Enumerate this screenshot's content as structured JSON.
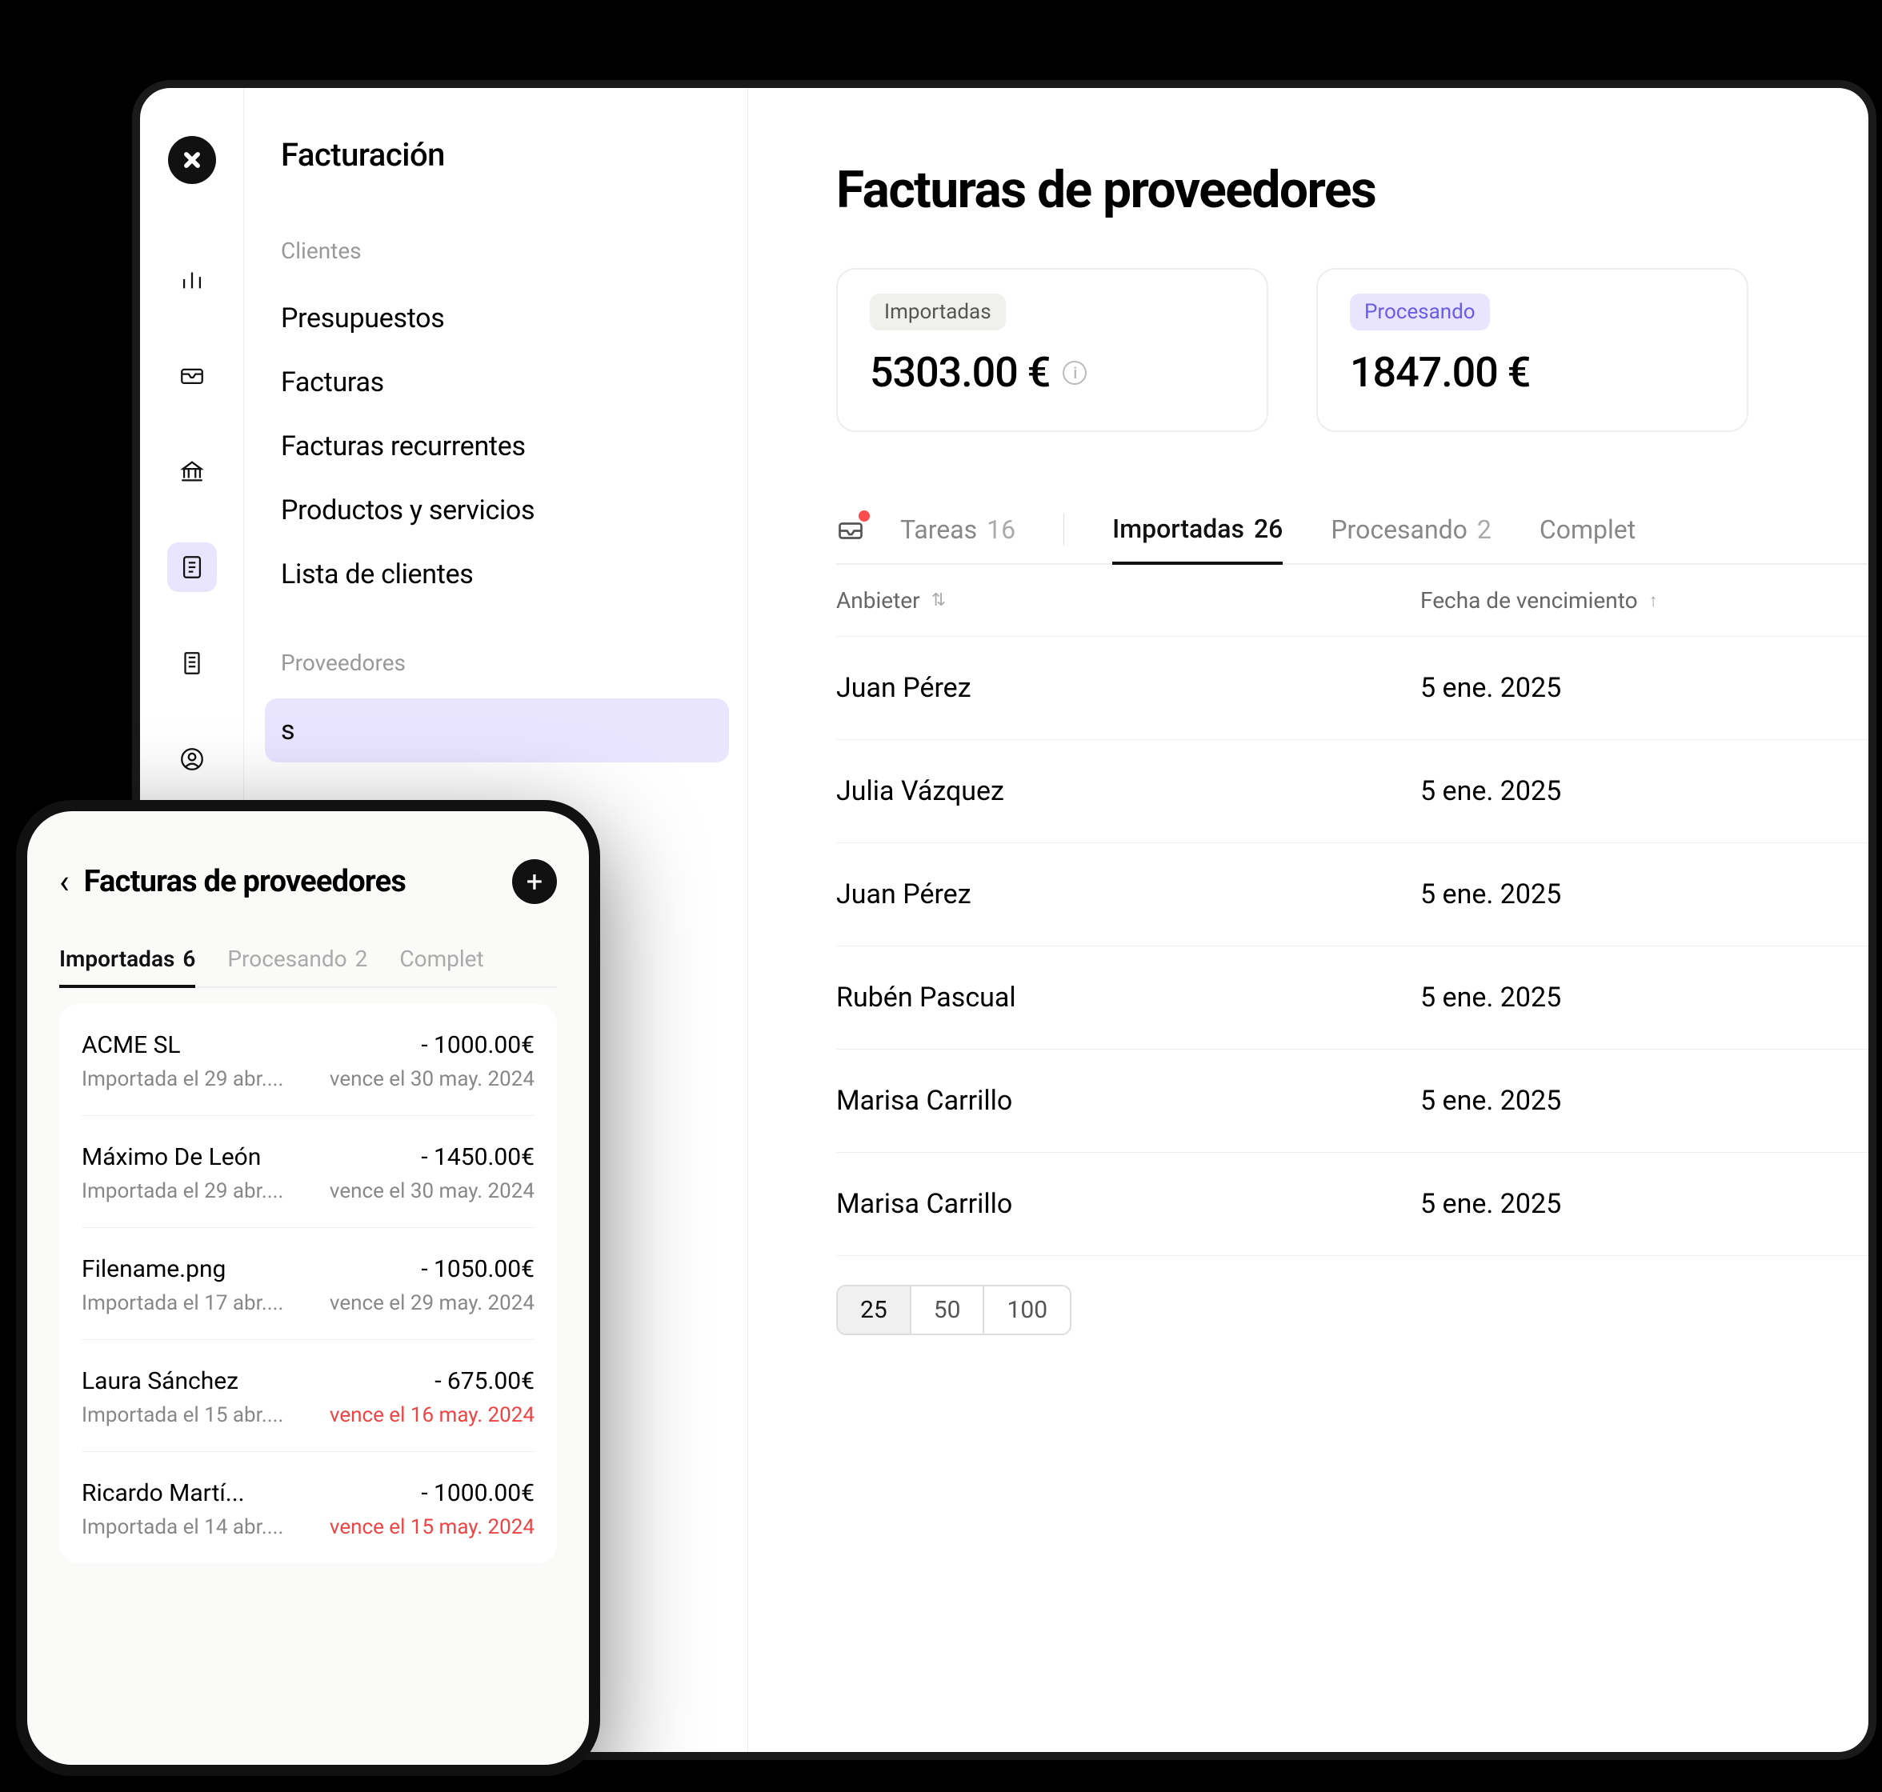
{
  "sidebar": {
    "app_title": "Facturación",
    "section_clients": "Clientes",
    "items_clients": [
      "Presupuestos",
      "Facturas",
      "Facturas recurrentes",
      "Productos y servicios",
      "Lista de clientes"
    ],
    "section_providers": "Proveedores",
    "items_providers_visible": "s"
  },
  "main": {
    "title": "Facturas de proveedores",
    "stats": {
      "imported": {
        "label": "Importadas",
        "value": "5303.00 €"
      },
      "processing": {
        "label": "Procesando",
        "value": "1847.00 €"
      }
    },
    "tabs": {
      "tasks": {
        "label": "Tareas",
        "count": "16"
      },
      "imported": {
        "label": "Importadas",
        "count": "26"
      },
      "processing": {
        "label": "Procesando",
        "count": "2"
      },
      "completed": {
        "label": "Complet"
      }
    },
    "columns": {
      "supplier": "Anbieter",
      "due": "Fecha de vencimiento"
    },
    "rows": [
      {
        "name": "Juan Pérez",
        "due": "5 ene. 2025"
      },
      {
        "name": "Julia Vázquez",
        "due": "5 ene. 2025"
      },
      {
        "name": "Juan Pérez",
        "due": "5 ene. 2025"
      },
      {
        "name": "Rubén Pascual",
        "due": "5 ene. 2025"
      },
      {
        "name": "Marisa Carrillo",
        "due": "5 ene. 2025"
      },
      {
        "name": "Marisa Carrillo",
        "due": "5 ene. 2025"
      }
    ],
    "pager": [
      "25",
      "50",
      "100"
    ]
  },
  "mobile": {
    "title": "Facturas de proveedores",
    "tabs": {
      "imported": {
        "label": "Importadas",
        "count": "6"
      },
      "processing": {
        "label": "Procesando",
        "count": "2"
      },
      "completed": {
        "label": "Complet"
      }
    },
    "rows": [
      {
        "name": "ACME SL",
        "amount": "- 1000.00€",
        "imported": "Importada el 29 abr....",
        "due": "vence el 30 may. 2024",
        "overdue": false
      },
      {
        "name": "Máximo De León",
        "amount": "- 1450.00€",
        "imported": "Importada el 29 abr....",
        "due": "vence el 30 may. 2024",
        "overdue": false
      },
      {
        "name": "Filename.png",
        "amount": "- 1050.00€",
        "imported": "Importada el 17 abr....",
        "due": "vence el 29 may. 2024",
        "overdue": false
      },
      {
        "name": "Laura Sánchez",
        "amount": "- 675.00€",
        "imported": "Importada el 15 abr....",
        "due": "vence el 16 may. 2024",
        "overdue": true
      },
      {
        "name": "Ricardo Martí...",
        "amount": "- 1000.00€",
        "imported": "Importada el 14 abr....",
        "due": "vence el 15 may. 2024",
        "overdue": true
      }
    ]
  }
}
